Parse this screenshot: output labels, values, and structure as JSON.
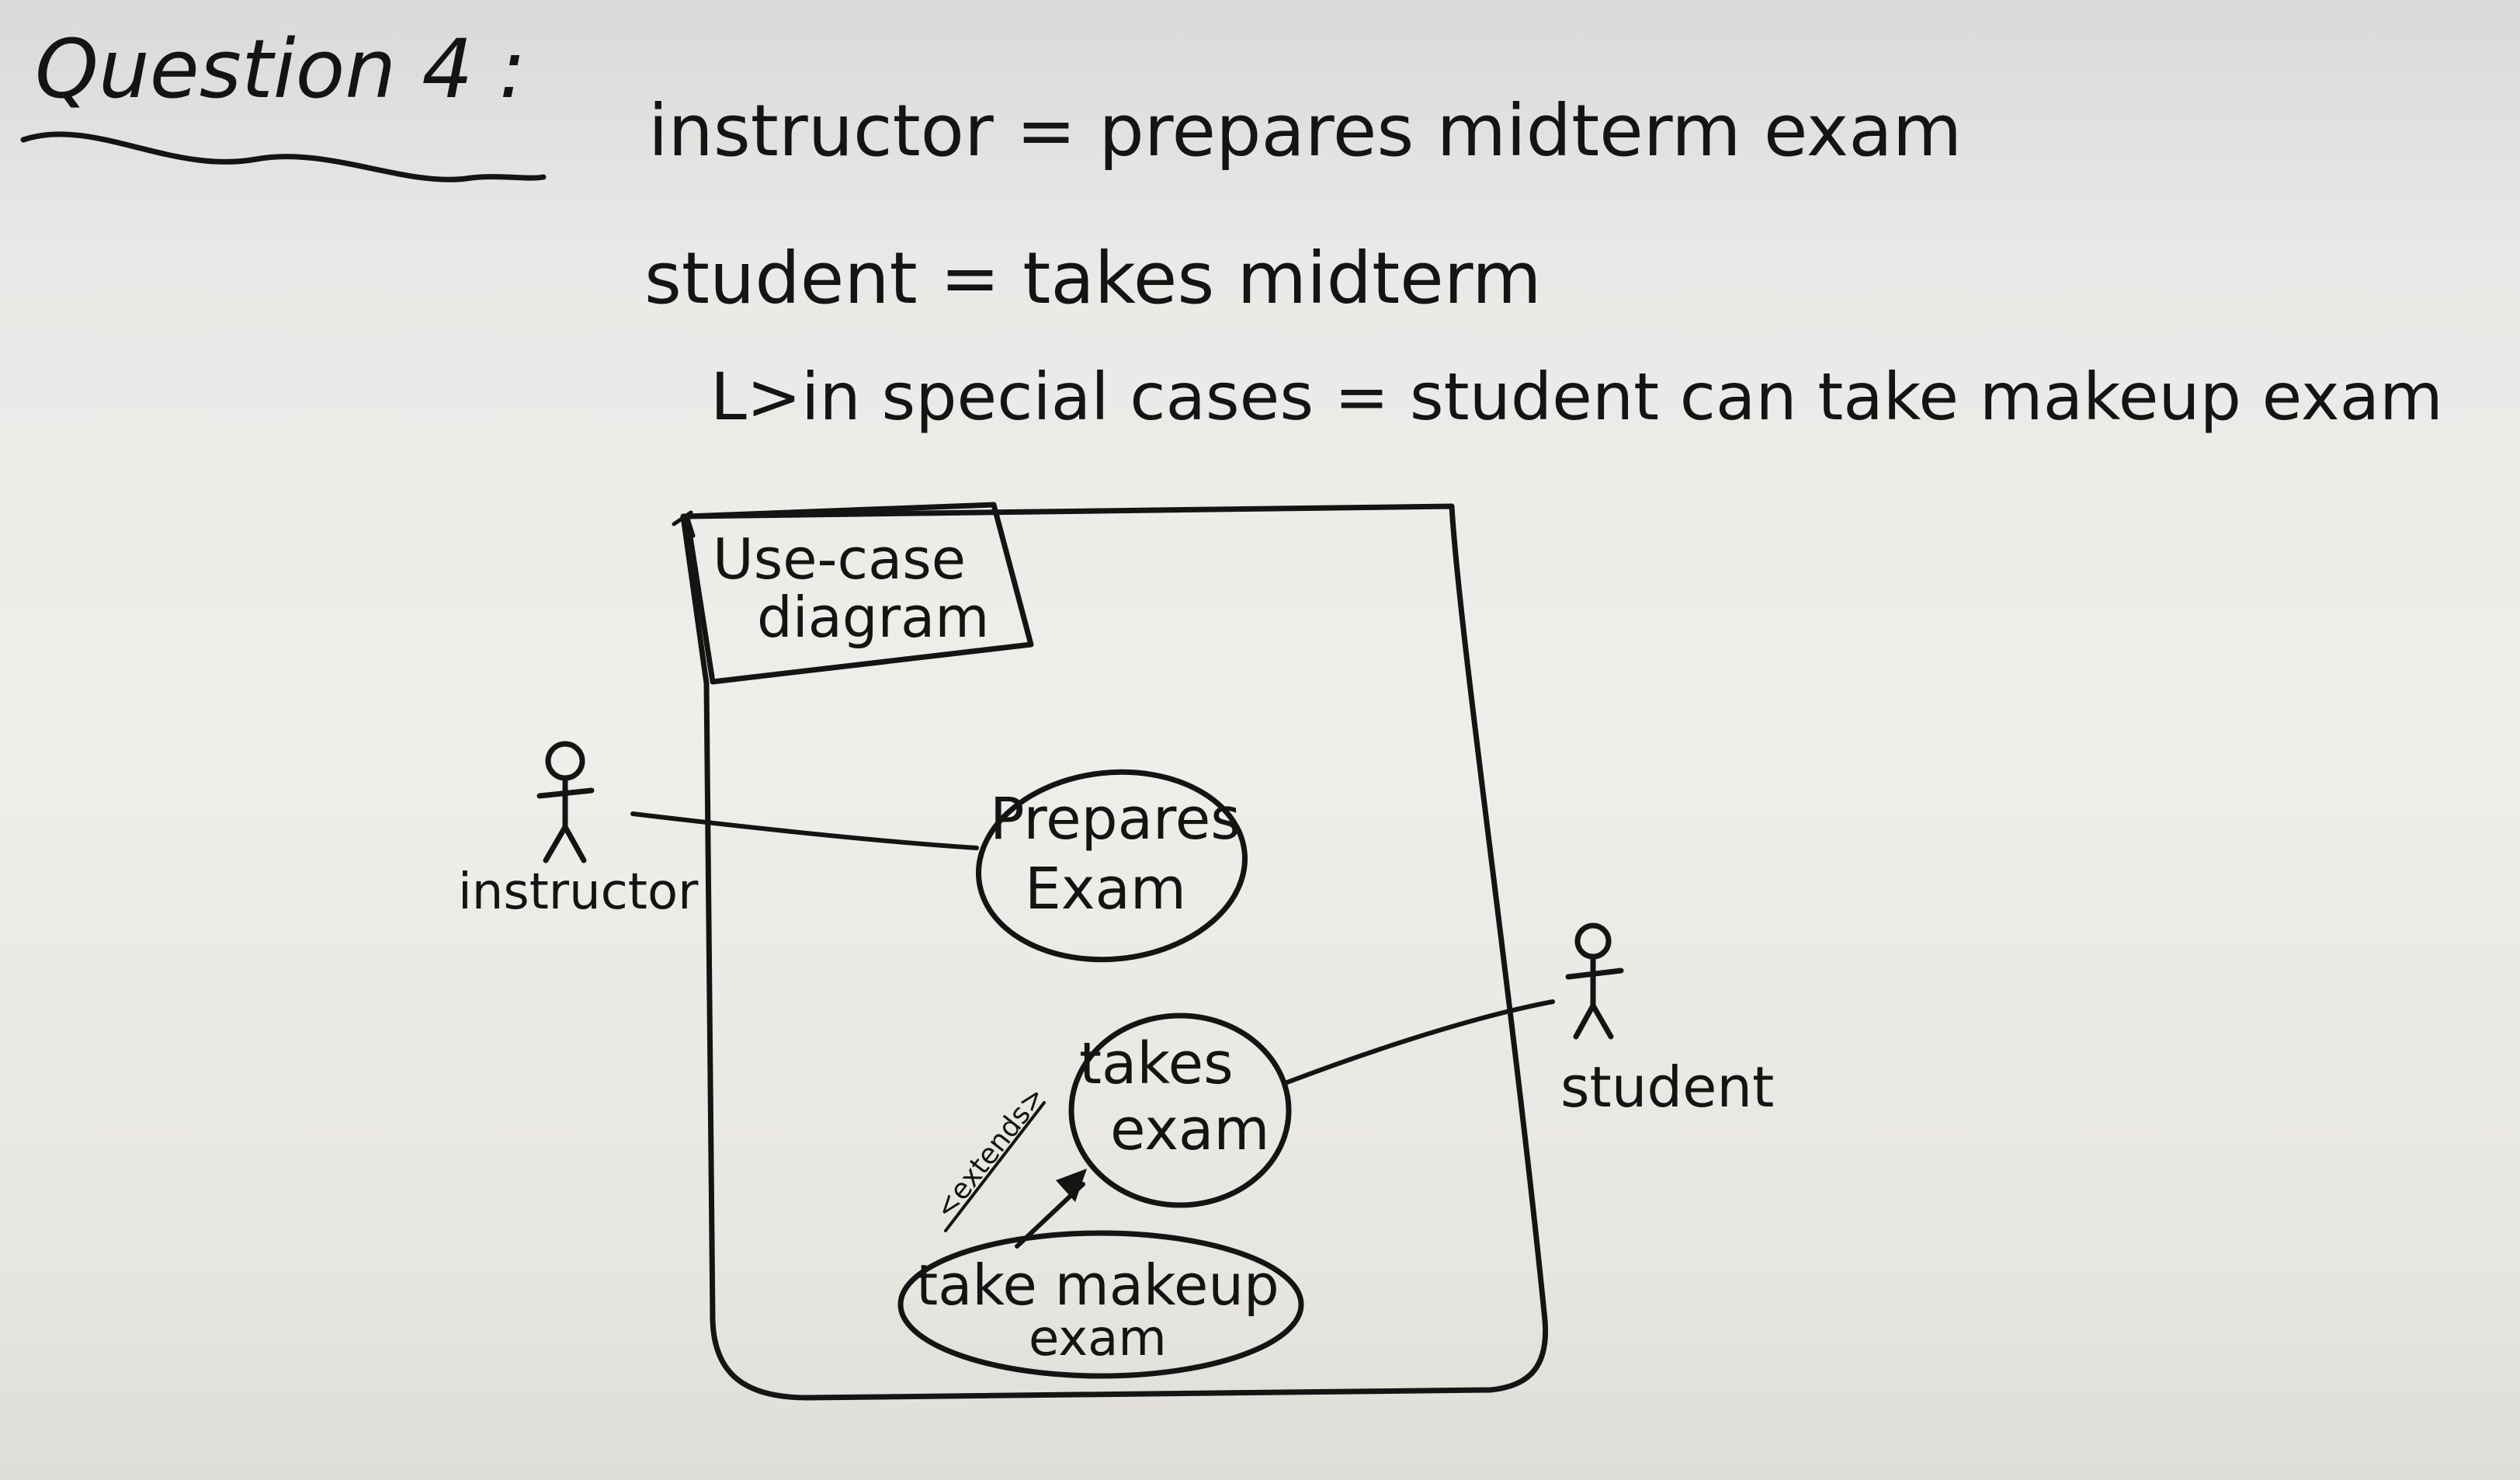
{
  "heading": "Question 4 :",
  "requirements": [
    "instructor = prepares midterm exam",
    "student = takes midterm",
    "L>in special cases = student can take makeup exam"
  ],
  "diagram": {
    "frame_title_line1": "Use-case",
    "frame_title_line2": "diagram",
    "actors": {
      "instructor": "instructor",
      "student": "student"
    },
    "use_cases": {
      "prepares_exam_line1": "Prepares",
      "prepares_exam_line2": "Exam",
      "takes_exam_line1": "takes",
      "takes_exam_line2": "exam",
      "makeup_line1": "take makeup",
      "makeup_line2": "exam"
    },
    "relationship_label": "<extends>"
  },
  "colors": {
    "ink": "#141414",
    "paper": "#ececE8"
  }
}
